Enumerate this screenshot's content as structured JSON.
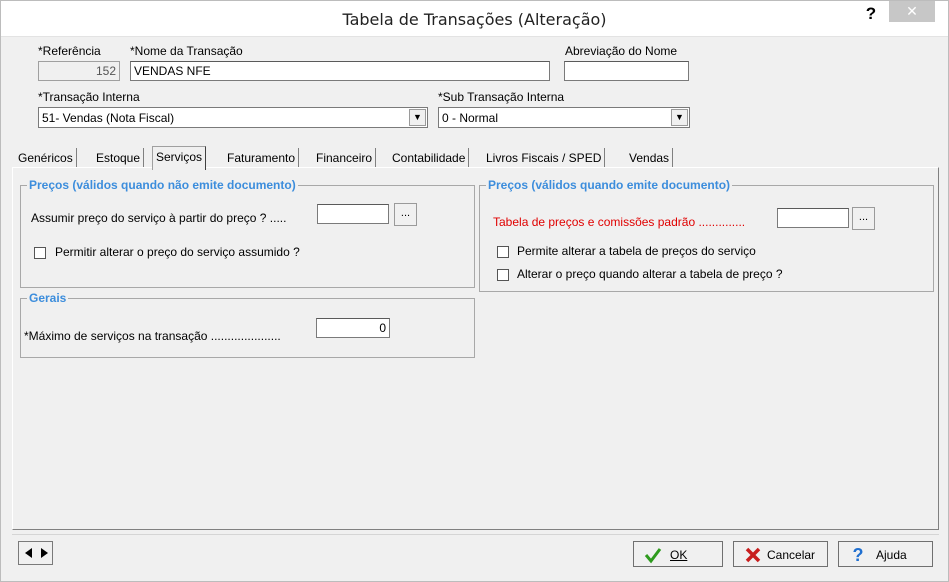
{
  "window": {
    "title": "Tabela de Transações (Alteração)",
    "help_glyph": "?",
    "close_glyph": "✕"
  },
  "header": {
    "referencia_label": "*Referência",
    "referencia_value": "152",
    "nome_label": "*Nome da Transação",
    "nome_value": "VENDAS NFE",
    "abreviacao_label": "Abreviação do Nome",
    "abreviacao_value": "",
    "transacao_interna_label": "*Transação Interna",
    "transacao_interna_value": "51- Vendas (Nota Fiscal)",
    "sub_transacao_label": "*Sub Transação Interna",
    "sub_transacao_value": "0 - Normal"
  },
  "tabs": [
    {
      "label": "Genéricos"
    },
    {
      "label": "Estoque"
    },
    {
      "label": "Serviços"
    },
    {
      "label": "Faturamento"
    },
    {
      "label": "Financeiro"
    },
    {
      "label": "Contabilidade"
    },
    {
      "label": "Livros Fiscais / SPED"
    },
    {
      "label": "Vendas"
    }
  ],
  "precos_sem_doc": {
    "title": "Preços (válidos quando não emite documento)",
    "assumir_label": "Assumir preço do serviço à partir do preço ? .....",
    "assumir_value": "",
    "permitir_label": "Permitir alterar o preço do serviço assumido ?"
  },
  "precos_com_doc": {
    "title": "Preços (válidos quando emite documento)",
    "tabela_label": "Tabela de preços e comissões padrão ..............",
    "tabela_value": "",
    "permite_label": "Permite alterar a tabela de preços do serviço",
    "alterar_label": "Alterar o preço quando alterar a tabela de preço ?"
  },
  "gerais": {
    "title": "Gerais",
    "maximo_label": "*Máximo de serviços na transação .....................",
    "maximo_value": "0"
  },
  "buttons": {
    "ellipsis": "...",
    "ok": "OK",
    "cancelar": "Cancelar",
    "ajuda": "Ajuda"
  },
  "colors": {
    "group_title": "#3c8ddc",
    "required_red": "#e00000",
    "ok_green": "#2e9b1e",
    "cancel_red": "#c81e1e",
    "help_blue": "#1f6fd0"
  }
}
